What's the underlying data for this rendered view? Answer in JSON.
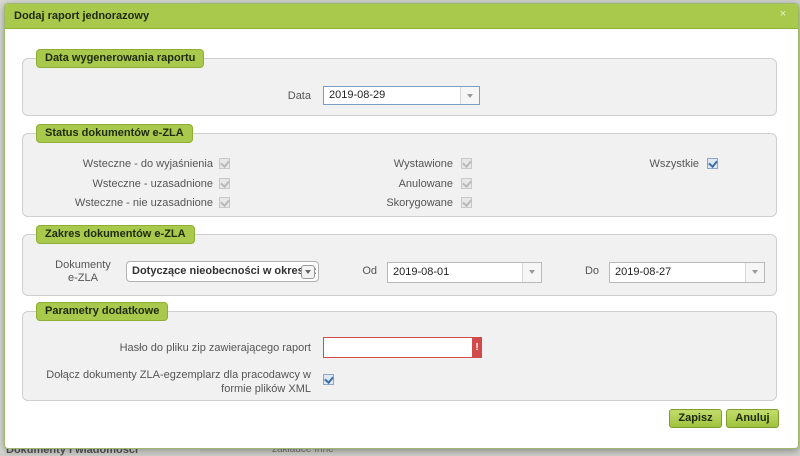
{
  "dialog": {
    "title": "Dodaj raport jednorazowy",
    "close_glyph": "×"
  },
  "background": {
    "left_menu_item": "Dokumenty i wiadomości",
    "main_text": "zakładce Inne"
  },
  "report_date": {
    "legend": "Data wygenerowania raportu",
    "date_label": "Data",
    "date_value": "2019-08-29"
  },
  "status": {
    "legend": "Status dokumentów e-ZLA",
    "items": [
      {
        "label": "Wsteczne - do wyjaśnienia",
        "checked": true
      },
      {
        "label": "Wsteczne - uzasadnione",
        "checked": true
      },
      {
        "label": "Wsteczne - nie uzasadnione",
        "checked": true
      },
      {
        "label": "Wystawione",
        "checked": true
      },
      {
        "label": "Anulowane",
        "checked": true
      },
      {
        "label": "Skorygowane",
        "checked": true
      },
      {
        "label": "Wszystkie",
        "checked": true
      }
    ]
  },
  "range": {
    "legend": "Zakres dokumentów e-ZLA",
    "docs_label_line1": "Dokumenty",
    "docs_label_line2": "e-ZLA",
    "docs_select_value": "Dotyczące nieobecności w okresie:",
    "from_label": "Od",
    "from_value": "2019-08-01",
    "to_label": "Do",
    "to_value": "2019-08-27"
  },
  "extra": {
    "legend": "Parametry dodatkowe",
    "password_label": "Hasło do pliku zip zawierającego raport",
    "password_value": "",
    "error_glyph": "!",
    "attach_label_line1": "Dołącz dokumenty ZLA-egzemplarz dla pracodawcy w",
    "attach_label_line2": "formie plików XML",
    "attach_checked": true
  },
  "buttons": {
    "save": "Zapisz",
    "cancel": "Anuluj"
  },
  "colors": {
    "accent": "#a8c94b",
    "accent_border": "#8fae34",
    "error": "#d24b4b"
  }
}
